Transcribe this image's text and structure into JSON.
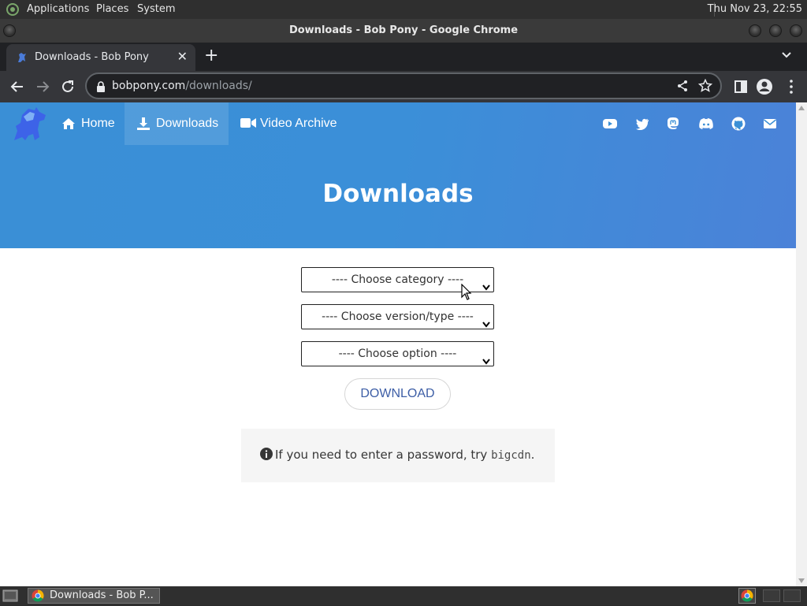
{
  "os_panel": {
    "menus": [
      "Applications",
      "Places",
      "System"
    ],
    "clock": "Thu Nov 23, 22:55"
  },
  "window": {
    "title": "Downloads - Bob Pony - Google Chrome"
  },
  "browser": {
    "tab_title": "Downloads - Bob Pony",
    "url_host": "bobpony.com",
    "url_path": "/downloads/"
  },
  "site": {
    "nav": {
      "home": "Home",
      "downloads": "Downloads",
      "video_archive": "Video Archive"
    },
    "social_icons": [
      "youtube-icon",
      "twitter-icon",
      "mastodon-icon",
      "discord-icon",
      "github-icon",
      "mail-icon"
    ],
    "hero_title": "Downloads",
    "selects": {
      "category": "---- Choose category ----",
      "version": "---- Choose version/type ----",
      "option": "---- Choose option ----"
    },
    "download_button": "DOWNLOAD",
    "notice": {
      "text": "If you need to enter a password, try ",
      "password": "bigcdn",
      "suffix": "."
    },
    "colors": {
      "hero": "#3a8fd6",
      "download_text": "#3d5ea6"
    }
  },
  "taskbar": {
    "task_label": "Downloads - Bob P..."
  }
}
